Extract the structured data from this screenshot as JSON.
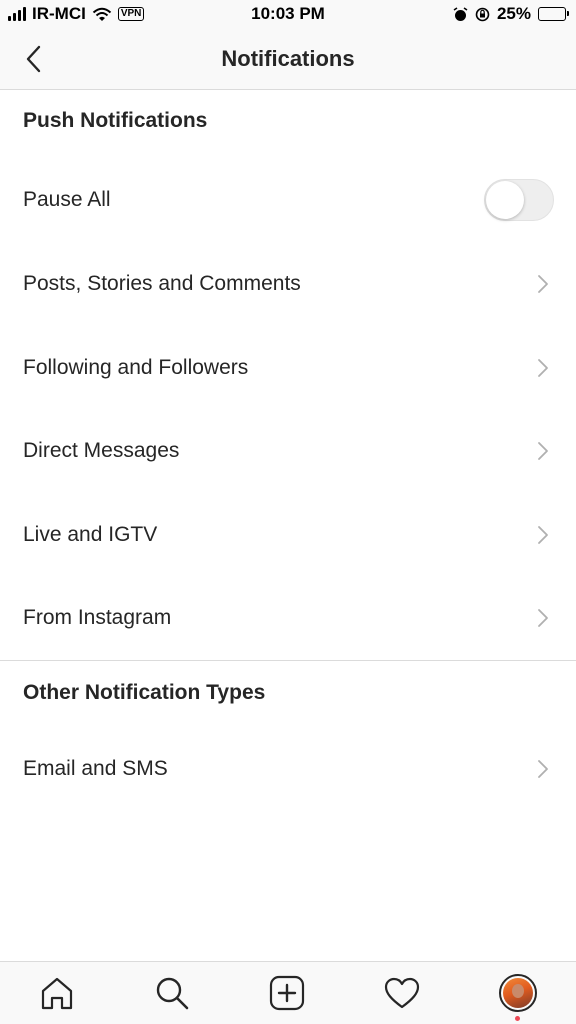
{
  "status_bar": {
    "carrier": "IR-MCI",
    "vpn": "VPN",
    "time": "10:03 PM",
    "battery": "25%",
    "battery_level": 0.25,
    "battery_color": "#f7c744"
  },
  "header": {
    "title": "Notifications",
    "back_icon": "chevron-left-icon"
  },
  "push": {
    "title": "Push Notifications",
    "pause_all": {
      "label": "Pause All",
      "enabled": false
    },
    "items": [
      {
        "label": "Posts, Stories and Comments"
      },
      {
        "label": "Following and Followers"
      },
      {
        "label": "Direct Messages"
      },
      {
        "label": "Live and IGTV"
      },
      {
        "label": "From Instagram"
      }
    ]
  },
  "other": {
    "title": "Other Notification Types",
    "items": [
      {
        "label": "Email and SMS"
      }
    ]
  },
  "tabbar": {
    "icons": [
      "home-icon",
      "search-icon",
      "add-post-icon",
      "heart-icon",
      "profile-avatar"
    ],
    "notification_dot_color": "#ed4956"
  }
}
